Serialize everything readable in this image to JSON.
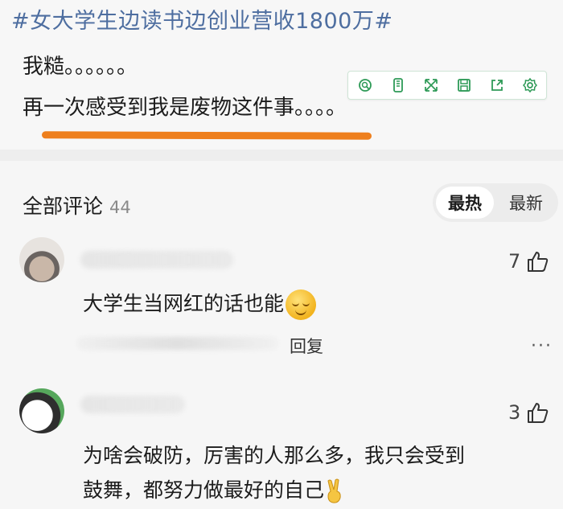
{
  "post": {
    "hashtag": "#女大学生边读书边创业营收1800万#",
    "line1": "我糙。。。。。。",
    "line2": "再一次感受到我是废物这件事。。。。"
  },
  "toolbar": {
    "icons": [
      "search-icon",
      "phone-icon",
      "expand-icon",
      "save-icon",
      "share-icon",
      "settings-icon"
    ]
  },
  "comments_section": {
    "title": "全部评论",
    "count": "44",
    "sort_hot": "最热",
    "sort_new": "最新"
  },
  "comments": [
    {
      "likes": "7",
      "text": "大学生当网红的话也能",
      "reply_label": "回复",
      "more": "···"
    },
    {
      "likes": "3",
      "text_line1": "为啥会破防，厉害的人那么多，我只会受到",
      "text_line2": "鼓舞，都努力做最好的自己"
    }
  ],
  "colors": {
    "hashtag": "#4e6ea0",
    "highlight": "#ee7f1d",
    "toolbar_accent": "#2e9a57"
  }
}
